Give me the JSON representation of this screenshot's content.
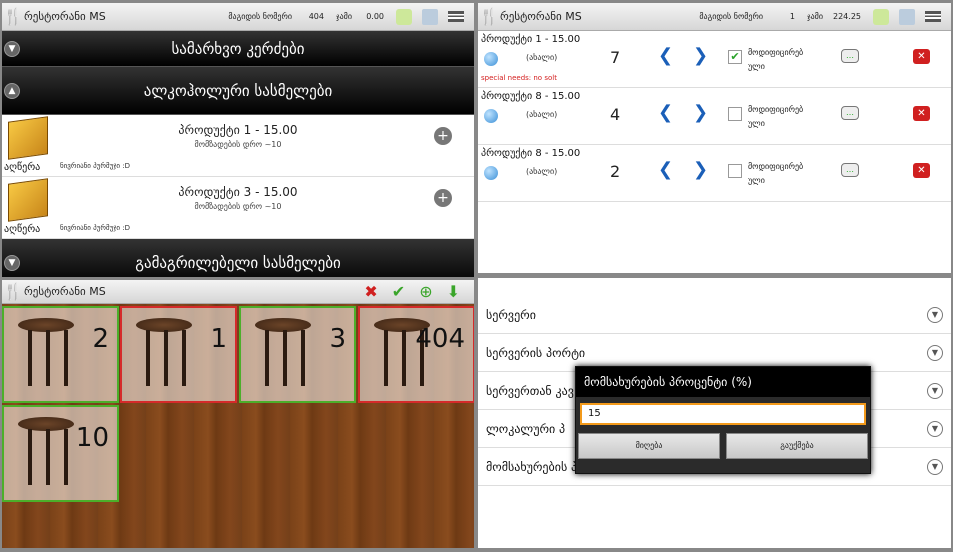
{
  "app": {
    "name": "რესტორანი MS"
  },
  "p1": {
    "table_label": "მაგიდის ნომერი",
    "table_no": "404",
    "sum_label": "ჯამი",
    "sum_val": "0.00",
    "cat1": "სამარხვო კერძები",
    "cat2": "ალკოჰოლური სასმელები",
    "cat3": "გამაგრილებელი სასმელები",
    "items": [
      {
        "name": "პროდუქტი 1 - 15.00",
        "time": "მომზადების დრო ~10",
        "prod": "აღწერა",
        "note": "ნივრიანი პურმუჯი :D"
      },
      {
        "name": "პროდუქტი 3 - 15.00",
        "time": "მომზადების დრო ~10",
        "prod": "აღწერა",
        "note": "ნივრიანი პურმუჯი :D"
      }
    ]
  },
  "p2": {
    "table_label": "მაგიდის ნომერი",
    "table_no": "1",
    "sum_label": "ჯამი",
    "sum_val": "224.25",
    "special": "special needs: no solt",
    "orders": [
      {
        "name": "პროდუქტი 1 - 15.00",
        "status": "(ახალი)",
        "qty": "7",
        "mod": "მოდიფიცირებ ული"
      },
      {
        "name": "პროდუქტი 8 - 15.00",
        "status": "(ახალი)",
        "qty": "4",
        "mod": "მოდიფიცირებ ული"
      },
      {
        "name": "პროდუქტი 8 - 15.00",
        "status": "(ახალი)",
        "qty": "2",
        "mod": "მოდიფიცირებ ული"
      }
    ]
  },
  "p3": {
    "tables": [
      "2",
      "1",
      "3",
      "404",
      "10"
    ]
  },
  "p4": {
    "rows": [
      "სერვერი",
      "სერვერის პორტი",
      "სერვერთან კავ",
      "ლოკალური პ",
      "მომსახურების პროცენტი (%)"
    ],
    "dialog_title": "მომსახურების პროცენტი (%)",
    "dialog_value": "15",
    "ok": "მიღება",
    "cancel": "გაუქმება"
  },
  "colors": {
    "accent_green": "#4caf2a",
    "accent_red": "#d52a2a",
    "input_focus": "#f39a1b"
  }
}
